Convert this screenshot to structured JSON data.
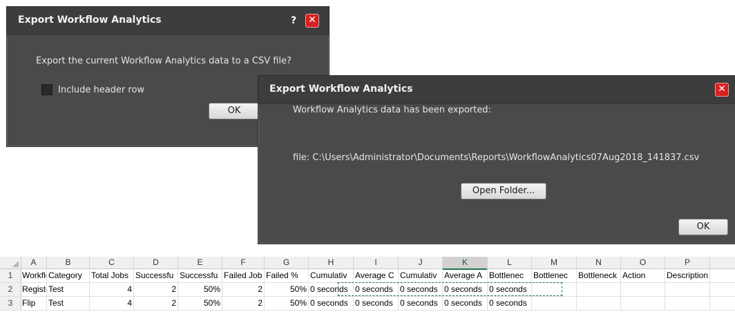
{
  "dialog1": {
    "title": "Export Workflow Analytics",
    "help_label": "?",
    "close_label": "✕",
    "message": "Export the current Workflow Analytics data to a CSV file?",
    "checkbox_label": "Include header row",
    "ok_label": "OK"
  },
  "dialog2": {
    "title": "Export Workflow Analytics",
    "close_label": "✕",
    "message": "Workflow Analytics data has been exported:",
    "file_text": "file: C:\\Users\\Administrator\\Documents\\Reports\\WorkflowAnalytics07Aug2018_141837.csv",
    "open_folder_label": "Open Folder...",
    "ok_label": "OK"
  },
  "sheet": {
    "columns": [
      "A",
      "B",
      "C",
      "D",
      "E",
      "F",
      "G",
      "H",
      "I",
      "J",
      "K",
      "L",
      "M",
      "N",
      "O",
      "P"
    ],
    "active_column": "K",
    "rows": [
      {
        "num": "1",
        "cells": [
          "Workflow",
          "Category",
          "Total Jobs",
          "Successfu",
          "Successfu",
          "Failed Job",
          "Failed %",
          "Cumulativ",
          "Average C",
          "Cumulativ",
          "Average A",
          "Bottlenec",
          "Bottlenec",
          "Bottleneck",
          "Action",
          "Description"
        ]
      },
      {
        "num": "2",
        "cells": [
          "Register",
          "Test",
          "4",
          "2",
          "50%",
          "2",
          "50%",
          "0 seconds",
          "0 seconds",
          "0 seconds",
          "0 seconds",
          "0 seconds",
          "",
          "",
          "",
          ""
        ]
      },
      {
        "num": "3",
        "cells": [
          "Flip",
          "Test",
          "4",
          "2",
          "50%",
          "2",
          "50%",
          "0 seconds",
          "0 seconds",
          "0 seconds",
          "0 seconds",
          "0 seconds",
          "",
          "",
          "",
          ""
        ]
      }
    ]
  }
}
